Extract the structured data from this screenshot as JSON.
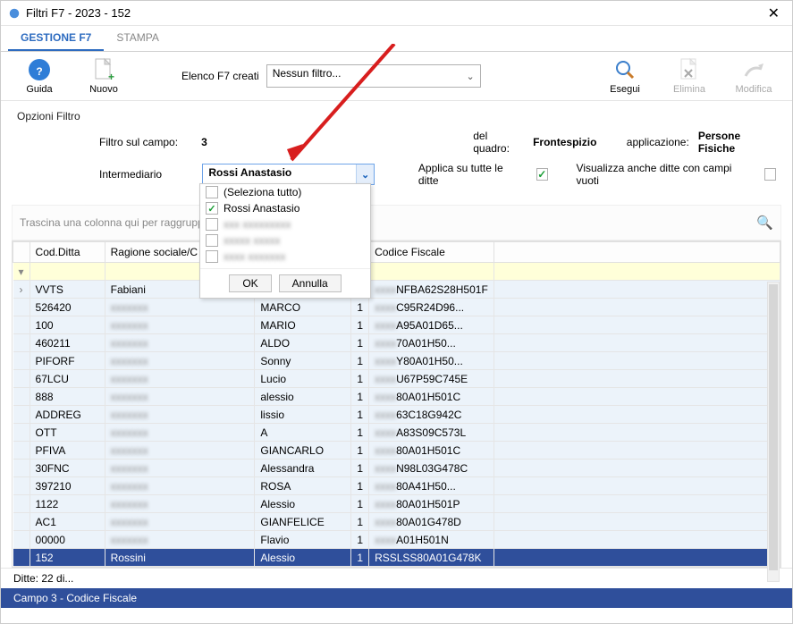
{
  "window": {
    "title": "Filtri F7 - 2023 - 152"
  },
  "tabs": {
    "gestione": "GESTIONE F7",
    "stampa": "STAMPA"
  },
  "toolbar": {
    "guida": "Guida",
    "nuovo": "Nuovo",
    "elenco_label": "Elenco F7 creati",
    "elenco_value": "Nessun filtro...",
    "esegui": "Esegui",
    "elimina": "Elimina",
    "modifica": "Modifica"
  },
  "options": {
    "title": "Opzioni Filtro",
    "campo_label": "Filtro sul campo:",
    "campo_value": "3",
    "quadro_label": "del quadro:",
    "quadro_value": "Frontespizio",
    "app_label": "applicazione:",
    "app_value": "Persone Fisiche",
    "intermed_label": "Intermediario",
    "intermed_value": "Rossi Anastasio",
    "applica_tutte": "Applica su tutte le ditte",
    "vis_vuoti": "Visualizza anche ditte con campi vuoti"
  },
  "dropdown": {
    "sel_all": "(Seleziona tutto)",
    "opt_checked": "Rossi Anastasio",
    "opt3": "xxx xxxxxxxxx",
    "opt4": "xxxxx xxxxx",
    "opt5": "xxxx xxxxxxx",
    "ok": "OK",
    "annulla": "Annulla"
  },
  "grid": {
    "hint_prefix": "Trascina una colonna qui per raggrupp",
    "col_cod": "Cod.Ditta",
    "col_rag": "Ragione sociale/C",
    "col_cf": "Codice Fiscale",
    "rows": [
      {
        "cod": "VVTS",
        "rag": "Fabiani",
        "nome": "",
        "num": "",
        "cf": "NFBA62S28H501F"
      },
      {
        "cod": "526420",
        "rag": "",
        "nome": "MARCO",
        "num": "1",
        "cf": "C95R24D96..."
      },
      {
        "cod": "100",
        "rag": "",
        "nome": "MARIO",
        "num": "1",
        "cf": "A95A01D65..."
      },
      {
        "cod": "460211",
        "rag": "",
        "nome": "ALDO",
        "num": "1",
        "cf": "70A01H50..."
      },
      {
        "cod": "PIFORF",
        "rag": "",
        "nome": "Sonny",
        "num": "1",
        "cf": "Y80A01H50..."
      },
      {
        "cod": "67LCU",
        "rag": "",
        "nome": "Lucio",
        "num": "1",
        "cf": "U67P59C745E"
      },
      {
        "cod": "888",
        "rag": "",
        "nome": "alessio",
        "num": "1",
        "cf": "80A01H501C"
      },
      {
        "cod": "ADDREG",
        "rag": "",
        "nome": "lissio",
        "num": "1",
        "cf": "63C18G942C"
      },
      {
        "cod": "OTT",
        "rag": "",
        "nome": "A",
        "num": "1",
        "cf": "A83S09C573L"
      },
      {
        "cod": "PFIVA",
        "rag": "",
        "nome": "GIANCARLO",
        "num": "1",
        "cf": "80A01H501C"
      },
      {
        "cod": "30FNC",
        "rag": "",
        "nome": "Alessandra",
        "num": "1",
        "cf": "N98L03G478C"
      },
      {
        "cod": "397210",
        "rag": "",
        "nome": "ROSA",
        "num": "1",
        "cf": "80A41H50..."
      },
      {
        "cod": "1122",
        "rag": "",
        "nome": "Alessio",
        "num": "1",
        "cf": "80A01H501P"
      },
      {
        "cod": "AC1",
        "rag": "",
        "nome": "GIANFELICE",
        "num": "1",
        "cf": "80A01G478D"
      },
      {
        "cod": "00000",
        "rag": "",
        "nome": "Flavio",
        "num": "1",
        "cf": "A01H501N"
      },
      {
        "cod": "152",
        "rag": "Rossini",
        "nome": "Alessio",
        "num": "1",
        "cf": "RSSLSS80A01G478K",
        "sel": true
      }
    ],
    "footer": "Ditte: 22 di..."
  },
  "status": "Campo 3 - Codice Fiscale"
}
